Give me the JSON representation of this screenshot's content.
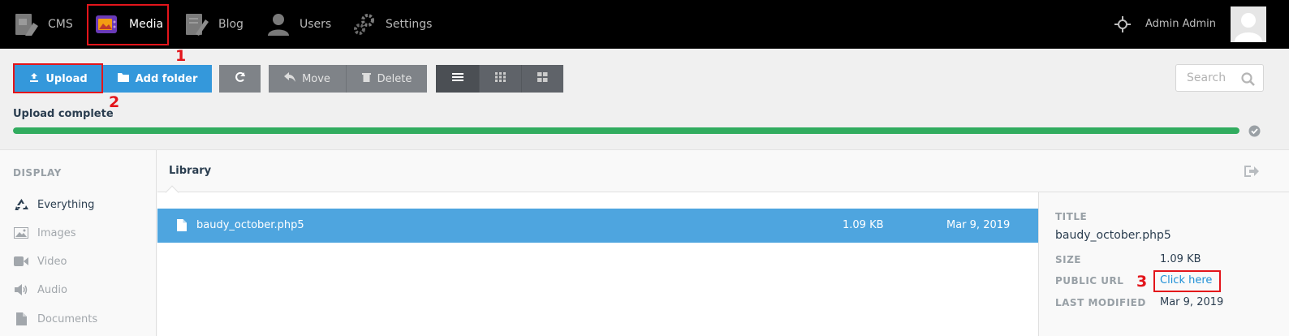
{
  "topnav": {
    "items": [
      {
        "label": "CMS",
        "icon": "cms-icon"
      },
      {
        "label": "Media",
        "icon": "media-icon"
      },
      {
        "label": "Blog",
        "icon": "blog-icon"
      },
      {
        "label": "Users",
        "icon": "users-icon"
      },
      {
        "label": "Settings",
        "icon": "settings-icon"
      }
    ],
    "active": "Media",
    "user_name": "Admin Admin"
  },
  "toolbar": {
    "upload_label": "Upload",
    "add_folder_label": "Add folder",
    "move_label": "Move",
    "delete_label": "Delete",
    "search_placeholder": "Search",
    "upload_status": "Upload complete",
    "upload_progress": 1.0
  },
  "sidebar": {
    "heading": "DISPLAY",
    "items": [
      {
        "label": "Everything",
        "icon": "recycle-icon"
      },
      {
        "label": "Images",
        "icon": "image-icon"
      },
      {
        "label": "Video",
        "icon": "video-icon"
      },
      {
        "label": "Audio",
        "icon": "audio-icon"
      },
      {
        "label": "Documents",
        "icon": "document-icon"
      }
    ],
    "active": "Everything"
  },
  "library": {
    "title": "Library",
    "files": [
      {
        "name": "baudy_october.php5",
        "size": "1.09 KB",
        "date": "Mar 9, 2019"
      }
    ]
  },
  "inspector": {
    "title_label": "TITLE",
    "title_value": "baudy_october.php5",
    "size_label": "SIZE",
    "size_value": "1.09 KB",
    "url_label": "PUBLIC URL",
    "url_value": "Click here",
    "modified_label": "LAST MODIFIED",
    "modified_value": "Mar 9, 2019"
  },
  "annotations": [
    "1",
    "2",
    "3"
  ],
  "colors": {
    "topbar": "#000000",
    "primary": "#3498db",
    "selected_row": "#4ea5df",
    "progress": "#31ac5f",
    "annotation": "#e3151b"
  }
}
